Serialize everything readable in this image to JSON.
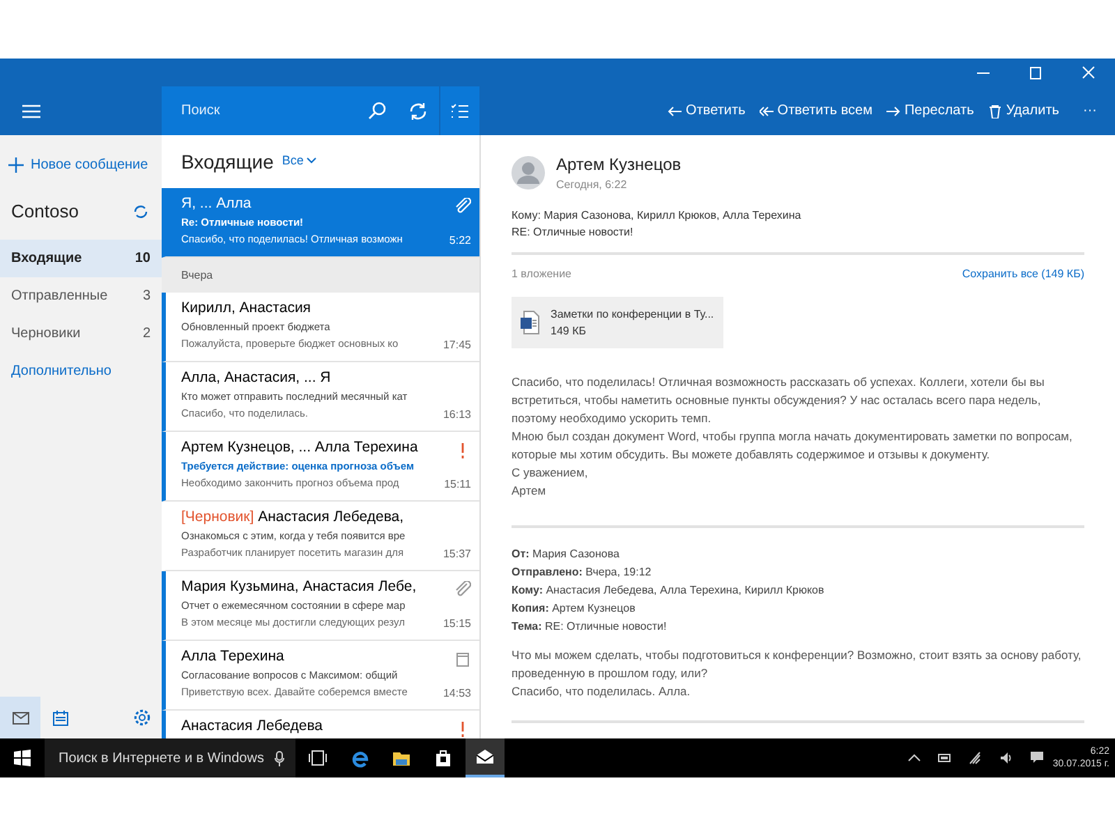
{
  "toolbar": {
    "search_placeholder": "Поиск",
    "actions": [
      {
        "kind": "reply",
        "label": "Ответить"
      },
      {
        "kind": "reply-all",
        "label": "Ответить всем"
      },
      {
        "kind": "forward",
        "label": "Переслать"
      },
      {
        "kind": "delete",
        "label": "Удалить"
      },
      {
        "kind": "more",
        "label": "···"
      }
    ]
  },
  "sidebar": {
    "new_message": "Новое сообщение",
    "account": "Contoso",
    "folders": [
      {
        "name": "Входящие",
        "count": "10",
        "selected": true
      },
      {
        "name": "Отправленные",
        "count": "3",
        "selected": false
      },
      {
        "name": "Черновики",
        "count": "2",
        "selected": false
      }
    ],
    "more": "Дополнительно"
  },
  "message_list": {
    "title": "Входящие",
    "filter": "Все",
    "items": [
      {
        "kind": "message",
        "from": "Я, ... Алла",
        "subject": "Re: Отличные новости!",
        "preview": "Спасибо, что поделилась! Отличная возможн",
        "time": "5:22",
        "attachment": true,
        "important": false,
        "meeting": false,
        "selected": true,
        "unread": false
      },
      {
        "kind": "group",
        "label": "Вчера"
      },
      {
        "kind": "message",
        "from": "Кирилл, Анастасия",
        "subject": "Обновленный проект бюджета",
        "preview": "Пожалуйста, проверьте бюджет основных ко",
        "time": "17:45",
        "attachment": false,
        "important": false,
        "meeting": false,
        "selected": false,
        "unread": true
      },
      {
        "kind": "message",
        "from": "Алла, Анастасия, ... Я",
        "subject": "Кто может отправить последний месячный кат",
        "preview": "Спасибо, что поделилась.",
        "time": "16:13",
        "attachment": false,
        "important": false,
        "meeting": false,
        "selected": false,
        "unread": true
      },
      {
        "kind": "message",
        "from": "Артем Кузнецов, ... Алла Терехина",
        "subject": "Требуется действие: оценка прогноза объем",
        "preview": "Необходимо закончить прогноз объема прод",
        "time": "15:11",
        "attachment": false,
        "important": true,
        "meeting": false,
        "selected": false,
        "unread": true,
        "action_required": true
      },
      {
        "kind": "message",
        "draft_label": "[Черновик]",
        "from": "Анастасия Лебедева,",
        "subject": "Ознакомься с этим, когда у тебя появится вре",
        "preview": "Разработчик планирует посетить магазин для",
        "time": "15:37",
        "attachment": false,
        "important": false,
        "meeting": false,
        "selected": false,
        "unread": false
      },
      {
        "kind": "message",
        "from": "Мария Кузьмина, Анастасия Лебе,",
        "subject": "Отчет о ежемесячном состоянии в сфере мар",
        "preview": "В этом месяце мы достигли следующих резул",
        "time": "15:15",
        "attachment": true,
        "important": false,
        "meeting": false,
        "selected": false,
        "unread": true
      },
      {
        "kind": "message",
        "from": "Алла Терехина",
        "subject": "Согласование вопросов с Максимом: общий",
        "preview": "Приветствую всех. Давайте соберемся вместе",
        "time": "14:53",
        "attachment": false,
        "important": false,
        "meeting": true,
        "selected": false,
        "unread": true
      },
      {
        "kind": "message",
        "from": "Анастасия Лебедева",
        "attachment": false,
        "important": true,
        "meeting": false,
        "selected": false,
        "unread": true
      }
    ]
  },
  "reading_pane": {
    "sender": "Артем Кузнецов",
    "date": "Сегодня, 6:22",
    "to": "Кому: Мария Сазонова, Кирилл Крюков, Алла Терехина",
    "subject": "RE: Отличные новости!",
    "attachments_count": "1 вложение",
    "save_all": "Сохранить все (149 КБ)",
    "attachment": {
      "name": "Заметки по конференции в Ту...",
      "size": "149 КБ"
    },
    "body": [
      "Спасибо, что поделилась! Отличная возможность рассказать об успехах. Коллеги, хотели бы вы встретиться, чтобы наметить основные пункты обсуждения? У нас осталась всего пара недель, поэтому необходимо ускорить темп.",
      "Мною был создан документ Word, чтобы группа могла начать документировать заметки по вопросам, которые мы хотим обсудить. Вы можете добавлять содержимое и отзывы к документу.",
      "С уважением,",
      "Артем"
    ],
    "quoted": {
      "headers": [
        {
          "label": "От:",
          "value": "Мария Сазонова"
        },
        {
          "label": "Отправлено:",
          "value": "Вчера, 19:12"
        },
        {
          "label": "Кому:",
          "value": "Анастасия Лебедева, Алла Терехина, Кирилл Крюков"
        },
        {
          "label": "Копия:",
          "value": "Артем Кузнецов"
        },
        {
          "label": "Тема:",
          "value": "RE: Отличные новости!"
        }
      ],
      "body": [
        "Что мы можем сделать, чтобы подготовиться к конференции? Возможно, стоит взять за основу работу, проведенную в прошлом году, или?",
        "Спасибо, что поделилась. Алла."
      ]
    }
  },
  "taskbar": {
    "search": "Поиск в Интернете и в Windows",
    "time": "6:22",
    "date": "30.07.2015 г."
  }
}
